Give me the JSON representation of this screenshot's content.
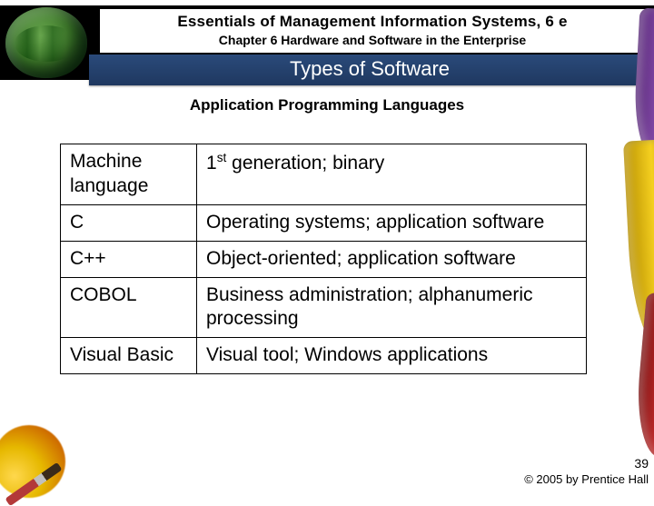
{
  "header": {
    "book_title": "Essentials of Management Information Systems, 6 e",
    "chapter": "Chapter 6 Hardware and Software in the Enterprise",
    "section_title": "Types of Software"
  },
  "subheader": "Application Programming Languages",
  "languages": [
    {
      "name": "Machine language",
      "desc_prefix": "1",
      "desc_sup": "st",
      "desc_suffix": " generation; binary"
    },
    {
      "name": "C",
      "desc": "Operating systems; application software"
    },
    {
      "name": "C++",
      "desc": "Object-oriented; application software"
    },
    {
      "name": "COBOL",
      "desc": "Business administration; alphanumeric processing"
    },
    {
      "name": "Visual Basic",
      "desc": "Visual tool; Windows applications"
    }
  ],
  "footer": {
    "page_number": "39",
    "copyright": "© 2005 by Prentice Hall"
  }
}
